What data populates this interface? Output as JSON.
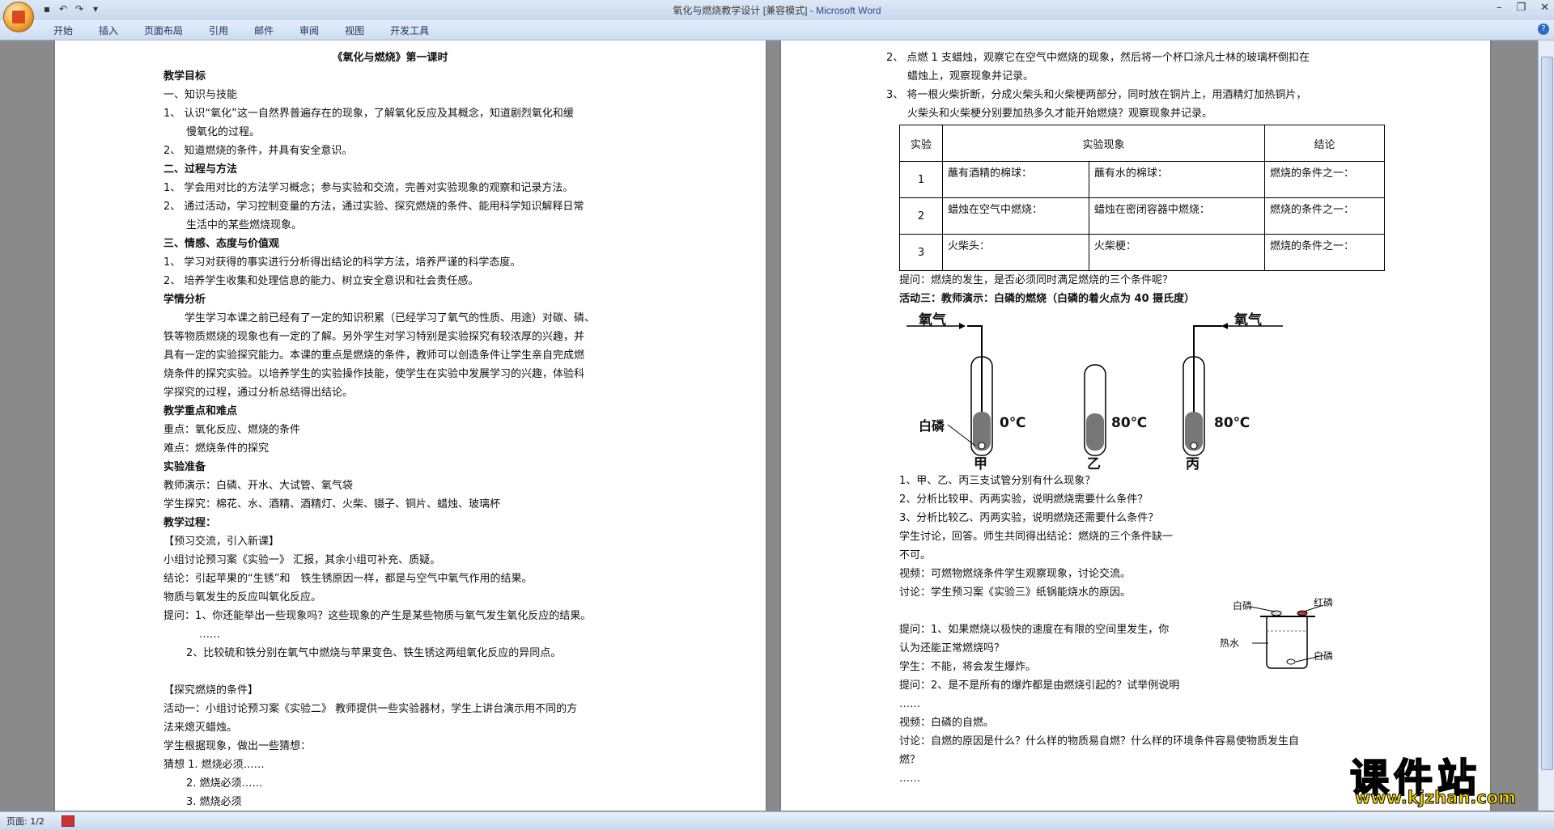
{
  "window": {
    "title": "氧化与燃烧教学设计 [兼容模式] - ",
    "app_name": "Microsoft Word",
    "minimize": "–",
    "restore": "❐",
    "close": "✕"
  },
  "qat": {
    "save_icon": "save-icon",
    "undo_icon": "undo-icon",
    "redo_icon": "redo-icon"
  },
  "ribbon_tabs": [
    "开始",
    "插入",
    "页面布局",
    "引用",
    "邮件",
    "审阅",
    "视图",
    "开发工具"
  ],
  "status": {
    "page": "页面: 1/2"
  },
  "watermark": {
    "main": "课件站",
    "url": "www.kjzhan.com"
  },
  "page1": {
    "title": "《氧化与燃烧》第一课时",
    "lines": [
      {
        "text": "教学目标",
        "cls": "b"
      },
      {
        "text": "一、知识与技能",
        "cls": ""
      },
      {
        "text": "1、 认识“氧化”这一自然界普遍存在的现象，了解氧化反应及其概念，知道剧烈氧化和缓",
        "cls": ""
      },
      {
        "text": "慢氧化的过程。",
        "cls": "ind1"
      },
      {
        "text": "2、 知道燃烧的条件，并具有安全意识。",
        "cls": ""
      },
      {
        "text": "二、过程与方法",
        "cls": "b"
      },
      {
        "text": "1、 学会用对比的方法学习概念；参与实验和交流，完善对实验现象的观察和记录方法。",
        "cls": ""
      },
      {
        "text": "2、 通过活动，学习控制变量的方法，通过实验、探究燃烧的条件、能用科学知识解释日常",
        "cls": ""
      },
      {
        "text": "生活中的某些燃烧现象。",
        "cls": "ind1"
      },
      {
        "text": "三、情感、态度与价值观",
        "cls": "b"
      },
      {
        "text": "1、 学习对获得的事实进行分析得出结论的科学方法，培养严谨的科学态度。",
        "cls": ""
      },
      {
        "text": "2、 培养学生收集和处理信息的能力、树立安全意识和社会责任感。",
        "cls": ""
      },
      {
        "text": "学情分析",
        "cls": "b"
      },
      {
        "text": "　　学生学习本课之前已经有了一定的知识积累（已经学习了氧气的性质、用途）对碳、磷、",
        "cls": ""
      },
      {
        "text": "铁等物质燃烧的现象也有一定的了解。另外学生对学习特别是实验探究有较浓厚的兴趣，并",
        "cls": ""
      },
      {
        "text": "具有一定的实验探究能力。本课的重点是燃烧的条件，教师可以创造条件让学生亲自完成燃",
        "cls": ""
      },
      {
        "text": "烧条件的探究实验。以培养学生的实验操作技能，使学生在实验中发展学习的兴趣，体验科",
        "cls": ""
      },
      {
        "text": "学探究的过程，通过分析总结得出结论。",
        "cls": ""
      },
      {
        "text": "教学重点和难点",
        "cls": "b"
      },
      {
        "text": "重点：氧化反应、燃烧的条件",
        "cls": ""
      },
      {
        "text": "难点：燃烧条件的探究",
        "cls": ""
      },
      {
        "text": "实验准备",
        "cls": "b"
      },
      {
        "text": "教师演示：白磷、开水、大试管、氧气袋",
        "cls": ""
      },
      {
        "text": "学生探究：棉花、水、酒精、酒精灯、火柴、镊子、铜片、蜡烛、玻璃杯",
        "cls": ""
      },
      {
        "text": "教学过程：",
        "cls": "b"
      },
      {
        "text": "【预习交流，引入新课】",
        "cls": ""
      },
      {
        "text": "小组讨论预习案《实验一》 汇报，其余小组可补充、质疑。",
        "cls": ""
      },
      {
        "text": "结论：引起苹果的“生锈”和　铁生锈原因一样，都是与空气中氧气作用的结果。",
        "cls": ""
      },
      {
        "text": "物质与氧发生的反应叫氧化反应。",
        "cls": ""
      },
      {
        "text": "提问：1、你还能举出一些现象吗？这些现象的产生是某些物质与氧气发生氧化反应的结果。",
        "cls": ""
      },
      {
        "text": "……",
        "cls": "ind2"
      },
      {
        "text": "2、比较硫和铁分别在氧气中燃烧与苹果变色、铁生锈这两组氧化反应的异同点。",
        "cls": "ind1"
      },
      {
        "text": "",
        "cls": ""
      },
      {
        "text": "【探究燃烧的条件】",
        "cls": ""
      },
      {
        "text": "活动一：小组讨论预习案《实验二》 教师提供一些实验器材，学生上讲台演示用不同的方",
        "cls": ""
      },
      {
        "text": "法来熄灭蜡烛。",
        "cls": ""
      },
      {
        "text": "学生根据现象，做出一些猜想：",
        "cls": ""
      },
      {
        "text": "猜想 1. 燃烧必须……",
        "cls": ""
      },
      {
        "text": "2. 燃烧必须……",
        "cls": "ind1"
      },
      {
        "text": "3. 燃烧必须",
        "cls": "ind1"
      }
    ]
  },
  "page2": {
    "lines_top": [
      "2、 点燃 1 支蜡烛，观察它在空气中燃烧的现象，然后将一个杯口涂凡士林的玻璃杯倒扣在",
      "　　蜡烛上，观察现象并记录。",
      "3、 将一根火柴折断，分成火柴头和火柴梗两部分，同时放在铜片上，用酒精灯加热铜片，",
      "　　火柴头和火柴梗分别要加热多久才能开始燃烧？观察现象并记录。"
    ],
    "table": {
      "headers": [
        "实验",
        "实验现象",
        "结论"
      ],
      "rows": [
        {
          "no": "1",
          "a": "蘸有酒精的棉球：",
          "b": "蘸有水的棉球：",
          "c": "燃烧的条件之一："
        },
        {
          "no": "2",
          "a": "蜡烛在空气中燃烧：",
          "b": "蜡烛在密闭容器中燃烧：",
          "c": "燃烧的条件之一："
        },
        {
          "no": "3",
          "a": "火柴头：",
          "b": "火柴梗：",
          "c": "燃烧的条件之一："
        }
      ]
    },
    "after_table": [
      {
        "text": "提问：燃烧的发生，是否必须同时满足燃烧的三个条件呢？",
        "cls": ""
      },
      {
        "text": "活动三：教师演示：白磷的燃烧（白磷的着火点为 40 摄氏度）",
        "cls": "act"
      }
    ],
    "figure1": {
      "oxygen": "氧气",
      "white_p": "白磷",
      "t0": "0℃",
      "t80a": "80℃",
      "t80b": "80℃",
      "jia": "甲",
      "yi": "乙",
      "bing": "丙"
    },
    "lines_bottom": [
      "1、甲、乙、丙三支试管分别有什么现象？",
      "2、分析比较甲、丙两实验，说明燃烧需要什么条件？",
      "3、分析比较乙、丙两实验，说明燃烧还需要什么条件？",
      "学生讨论，回答。师生共同得出结论：燃烧的三个条件缺一",
      "不可。",
      "视频：可燃物燃烧条件学生观察现象，讨论交流。",
      "讨论：学生预习案《实验三》纸锅能烧水的原因。",
      "",
      "提问：1、如果燃烧以极快的速度在有限的空间里发生，你",
      "认为还能正常燃烧吗？",
      "学生：不能，将会发生爆炸。",
      "提问：2、是不是所有的爆炸都是由燃烧引起的？试举例说明",
      "……",
      "视频：白磷的自燃。",
      "讨论：自燃的原因是什么？什么样的物质易自燃？什么样的环境条件容易使物质发生自",
      "燃？",
      "……"
    ],
    "figure2": {
      "white_p_top": "白磷",
      "red_p": "红磷",
      "hot_water": "热水",
      "white_p_bottom": "白磷"
    }
  }
}
